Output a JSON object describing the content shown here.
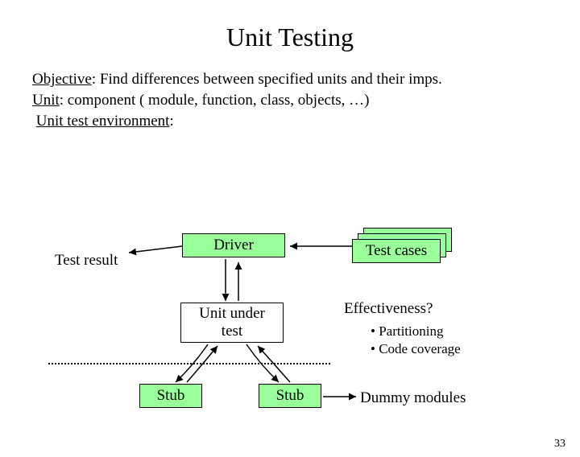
{
  "title": "Unit Testing",
  "intro": {
    "objective_label": "Objective",
    "objective_text": ":  Find differences between specified units and their imps.",
    "unit_label": "Unit",
    "unit_text": ": component ( module, function, class, objects, …)",
    "env_label": "Unit test environment",
    "env_suffix": ":"
  },
  "diagram": {
    "test_result": "Test result",
    "driver": "Driver",
    "test_cases": "Test cases",
    "unit_under_test": "Unit under\ntest",
    "stub": "Stub",
    "effectiveness": "Effectiveness?",
    "bullet1": "• Partitioning",
    "bullet2": "• Code coverage",
    "dummy_modules": "Dummy modules"
  },
  "page_number": "33"
}
